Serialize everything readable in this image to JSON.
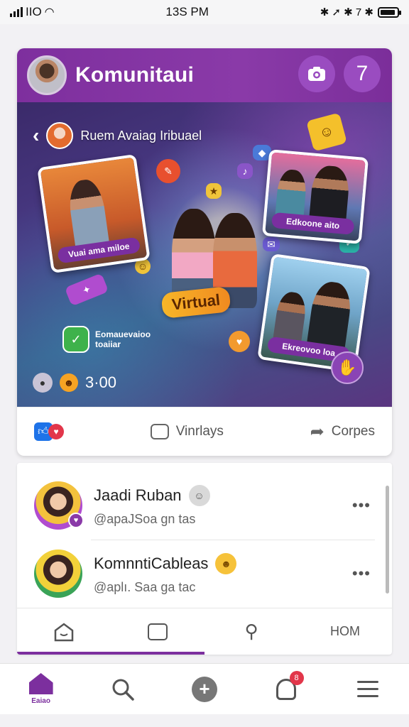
{
  "status_bar": {
    "carrier": "IIO",
    "time": "13S PM",
    "icons_right": "✱ ➚ ✱ 7 ✱",
    "battery_level": 0.9
  },
  "header": {
    "title": "Komunitaui",
    "badge_count": "7"
  },
  "hero": {
    "label": "Ruem Avaiag Iribuael",
    "tag": "Virtual",
    "photo_captions": [
      "Vuai ama miloe",
      "Edkoone aito",
      "Ekreovoo loa"
    ],
    "side_label": "Eomauevaioo toaiiar",
    "stat_count": "3·00"
  },
  "actions": {
    "comment_label": "Vinrlays",
    "share_label": "Corpes"
  },
  "list": [
    {
      "name": "Jaadi Ruban",
      "handle": "@apaJSoa gn tas"
    },
    {
      "name": "KomnntiCableas",
      "handle": "@aplı. Saa ga tac"
    }
  ],
  "tabs": {
    "last_label": "HOM"
  },
  "bottom_nav": {
    "home_label": "Eaiao",
    "notification_count": "8"
  },
  "colors": {
    "brand": "#7c2f9e",
    "accent": "#f6a323"
  }
}
